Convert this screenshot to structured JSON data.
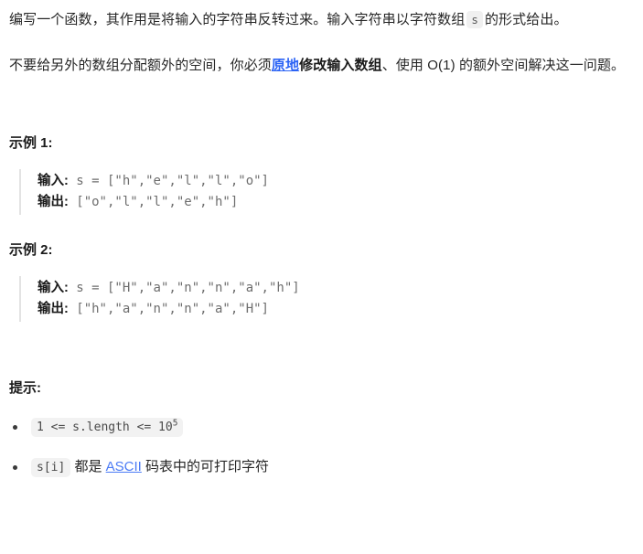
{
  "description": {
    "paragraph1": {
      "before_code": "编写一个函数，其作用是将输入的字符串反转过来。输入字符串以字符数组",
      "inline_code": "s",
      "after_code": "的形式给出。"
    },
    "paragraph2": {
      "part1": "不要给另外的数组分配额外的空间，你必须",
      "link_text": "原地",
      "bold_text": "修改输入数组",
      "part2": "、使用 O(1) 的额外空间解决这一问题。"
    }
  },
  "examples": [
    {
      "title": "示例 1:",
      "input_label": "输入:",
      "input_value": " s = [\"h\",\"e\",\"l\",\"l\",\"o\"]",
      "output_label": "输出:",
      "output_value": " [\"o\",\"l\",\"l\",\"e\",\"h\"]"
    },
    {
      "title": "示例 2:",
      "input_label": "输入:",
      "input_value": " s = [\"H\",\"a\",\"n\",\"n\",\"a\",\"h\"]",
      "output_label": "输出:",
      "output_value": " [\"h\",\"a\",\"n\",\"n\",\"a\",\"H\"]"
    }
  ],
  "constraints": {
    "title": "提示:",
    "items": [
      {
        "code_prefix": "1 <= s.length <= 10",
        "code_superscript": "5",
        "text_after": ""
      },
      {
        "code_prefix": "s[i]",
        "code_superscript": "",
        "text_before_link": " 都是 ",
        "link_text": "ASCII",
        "text_after": " 码表中的可打印字符"
      }
    ]
  },
  "colors": {
    "text": "#262626",
    "link": "#2b63f5",
    "link_light": "#4b7bf5",
    "code_text": "#6e6e6e",
    "chip_bg": "#f0f0f0",
    "border": "#e3e3e3"
  }
}
